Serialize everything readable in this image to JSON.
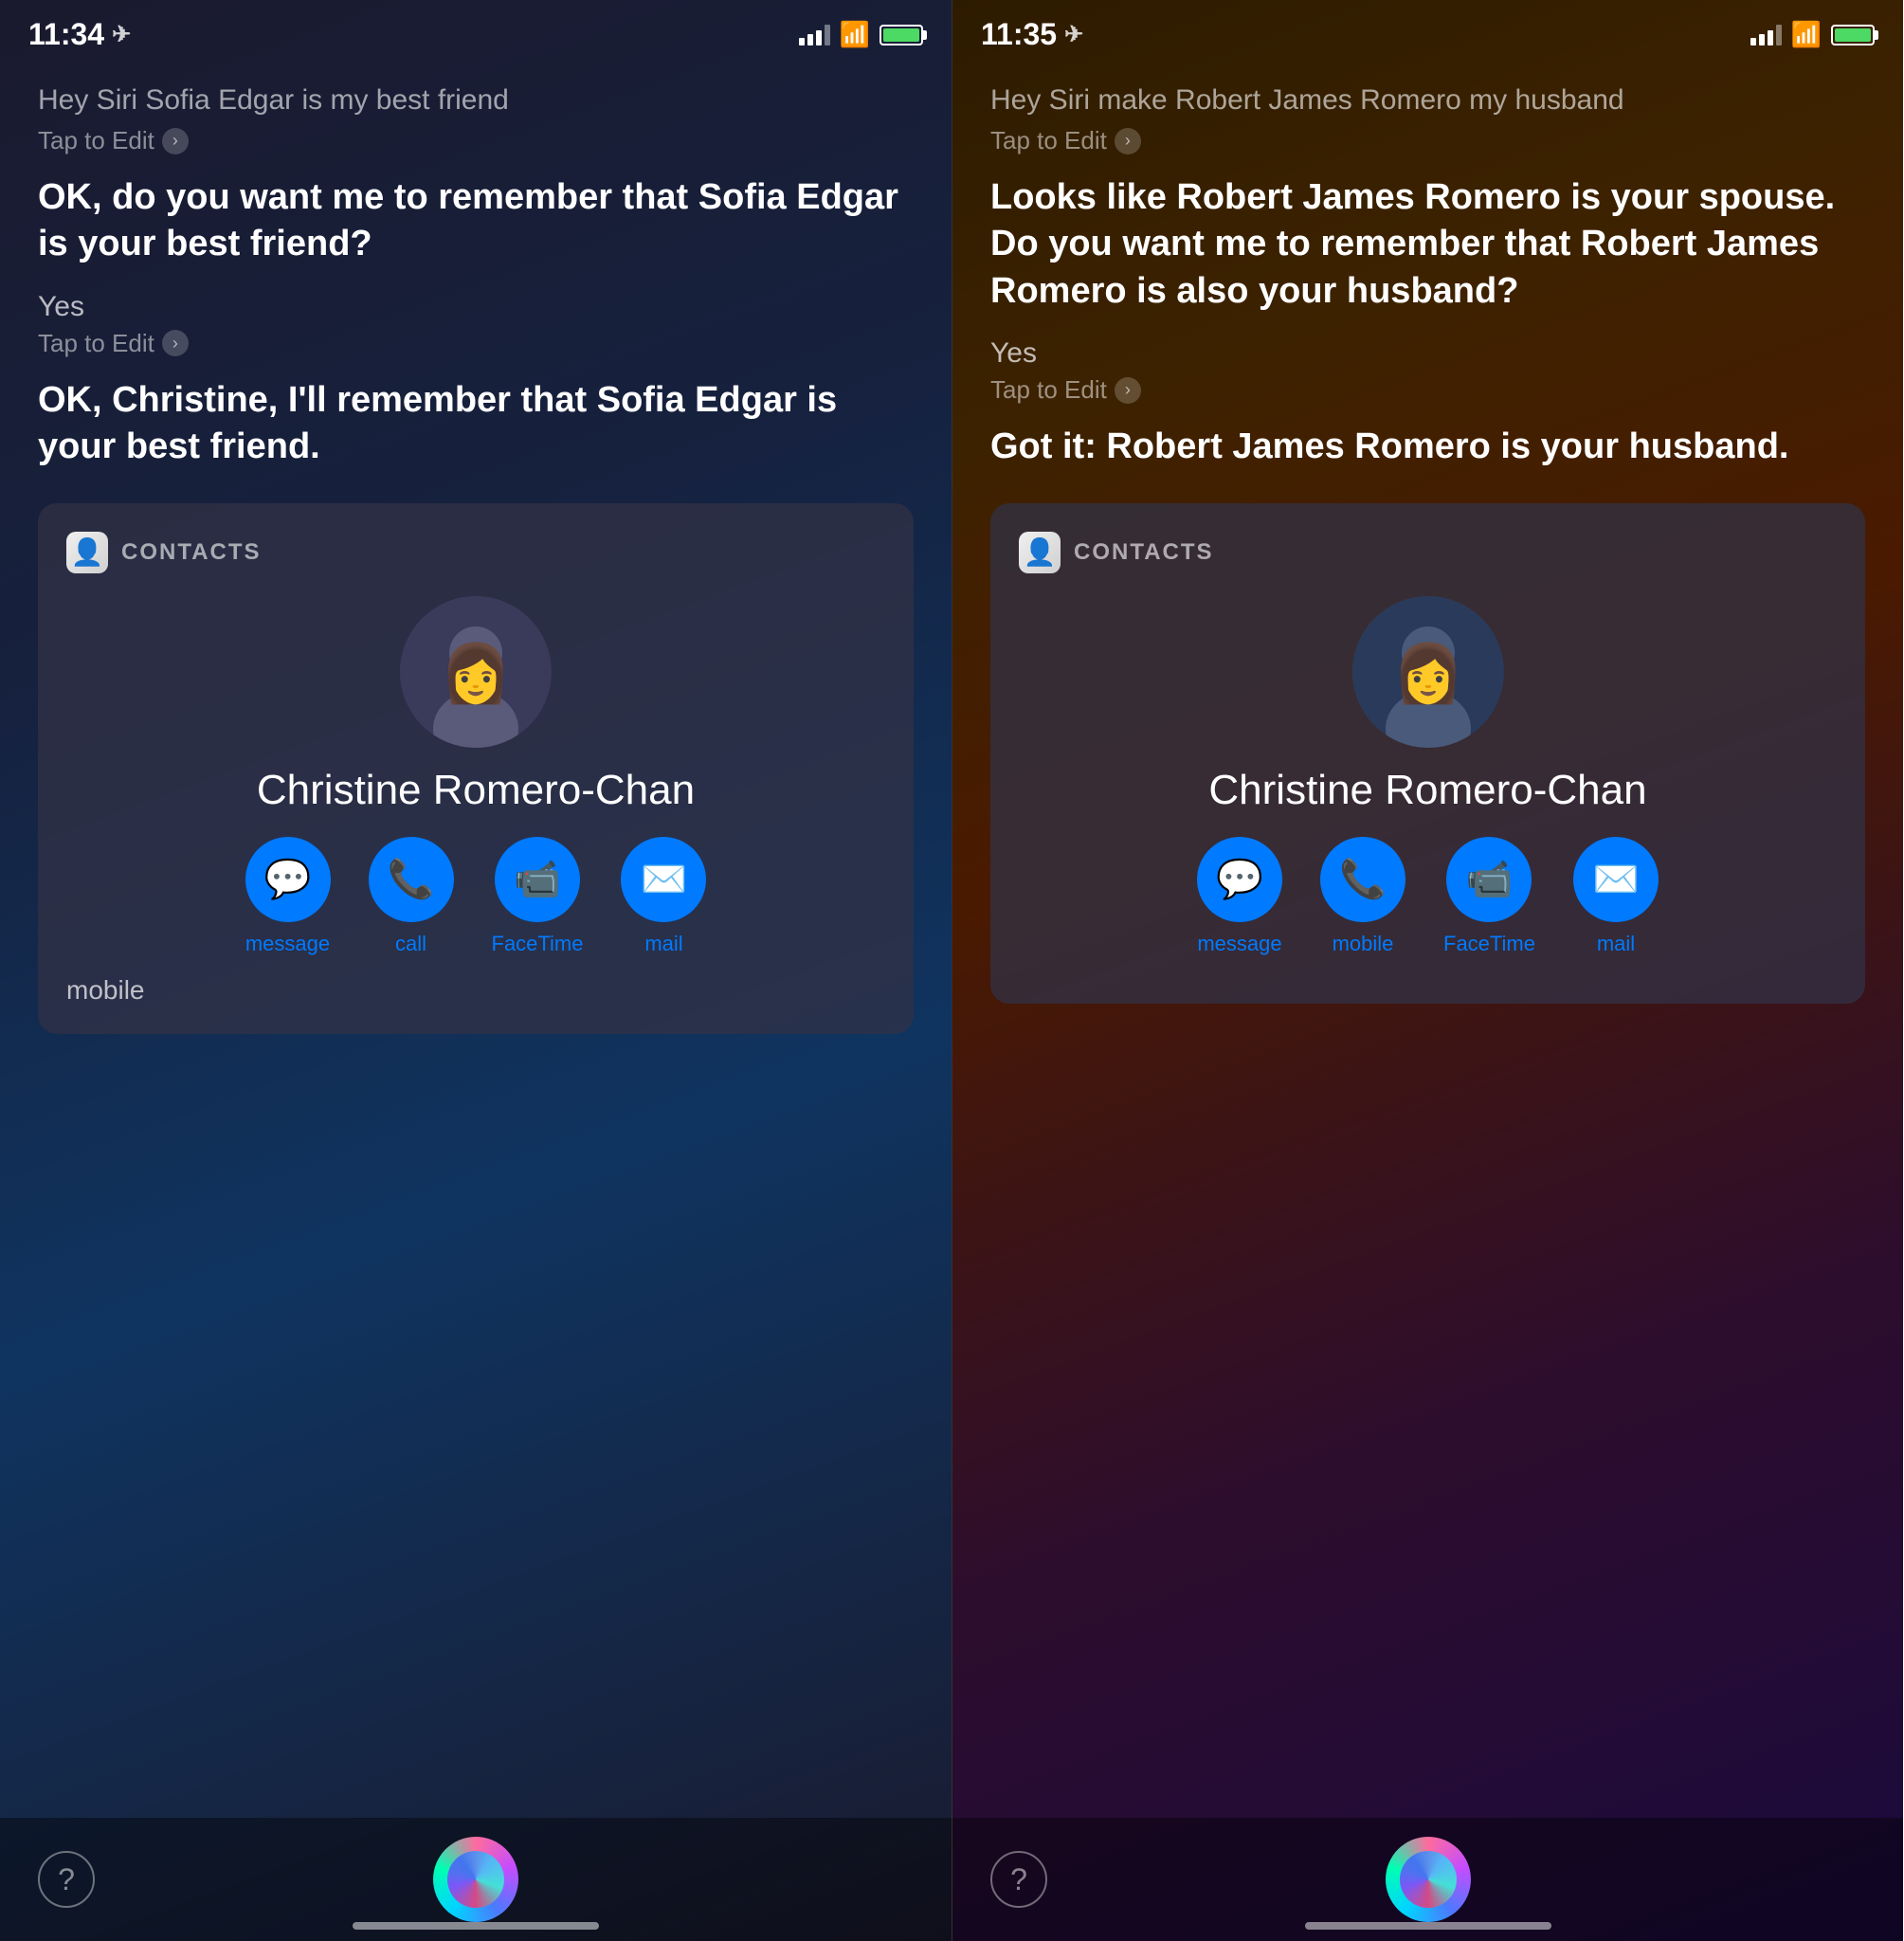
{
  "left": {
    "status": {
      "time": "11:34",
      "location_arrow": "↑"
    },
    "query1": {
      "text": "Hey Siri Sofia Edgar is my best friend",
      "tap_to_edit": "Tap to Edit"
    },
    "siri_response1": "OK, do you want me to remember that Sofia Edgar is your best friend?",
    "query2": {
      "text": "Yes",
      "tap_to_edit": "Tap to Edit"
    },
    "siri_response2": "OK, Christine, I'll remember that Sofia Edgar is your best friend.",
    "contacts": {
      "label": "CONTACTS",
      "contact_name": "Christine Romero-Chan",
      "actions": [
        {
          "label": "message",
          "icon": "💬"
        },
        {
          "label": "call",
          "icon": "📞"
        },
        {
          "label": "FaceTime",
          "icon": "📹"
        },
        {
          "label": "mail",
          "icon": "✉️"
        }
      ],
      "mobile_label": "mobile"
    },
    "bottom": {
      "help": "?",
      "home_indicator": ""
    }
  },
  "right": {
    "status": {
      "time": "11:35",
      "location_arrow": "↑"
    },
    "query1": {
      "text": "Hey Siri make Robert James Romero my husband",
      "tap_to_edit": "Tap to Edit"
    },
    "siri_response1": "Looks like Robert James Romero is your spouse. Do you want me to remember that Robert James Romero is also your husband?",
    "query2": {
      "text": "Yes",
      "tap_to_edit": "Tap to Edit"
    },
    "siri_response2": "Got it: Robert James Romero is your husband.",
    "contacts": {
      "label": "CONTACTS",
      "contact_name": "Christine Romero-Chan",
      "actions": [
        {
          "label": "message",
          "icon": "💬"
        },
        {
          "label": "mobile",
          "icon": "📞"
        },
        {
          "label": "FaceTime",
          "icon": "📹"
        },
        {
          "label": "mail",
          "icon": "✉️"
        }
      ]
    },
    "bottom": {
      "help": "?",
      "home_indicator": ""
    }
  }
}
